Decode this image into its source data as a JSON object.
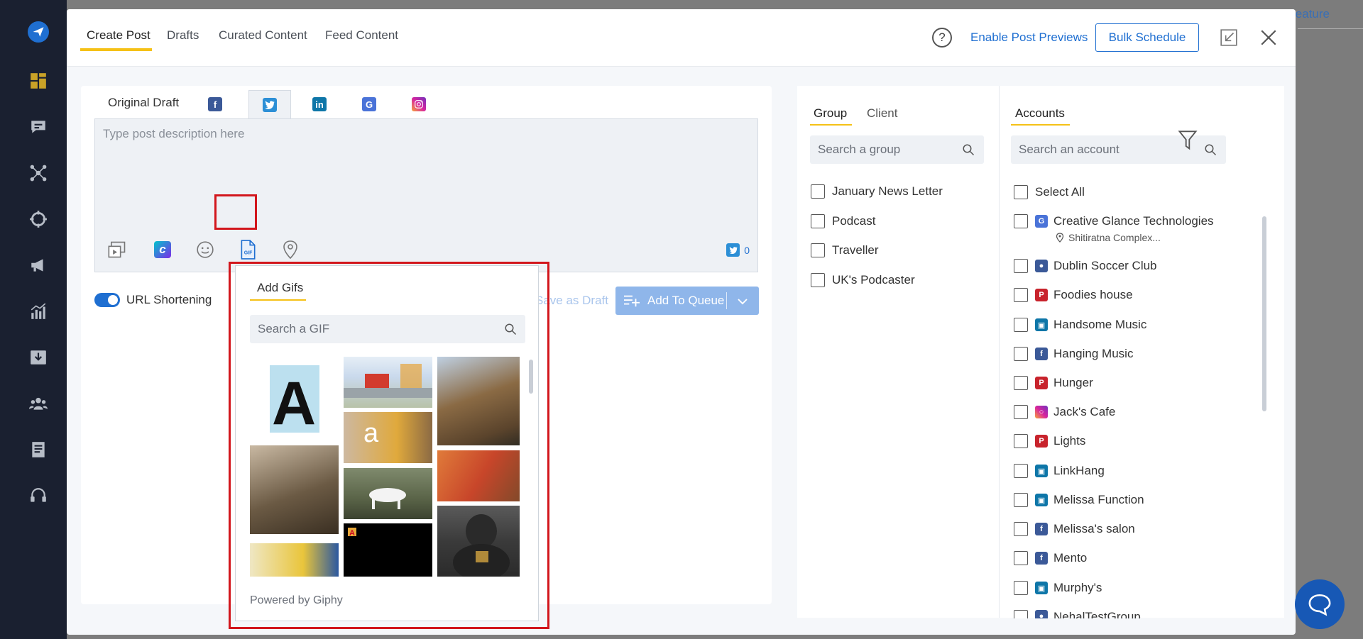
{
  "background": {
    "feature_text": "eature"
  },
  "header": {
    "tabs": [
      {
        "label": "Create Post"
      },
      {
        "label": "Drafts"
      },
      {
        "label": "Curated Content"
      },
      {
        "label": "Feed Content"
      }
    ],
    "help_glyph": "?",
    "enable_previews": "Enable Post Previews",
    "bulk_schedule": "Bulk Schedule"
  },
  "composer": {
    "original_draft": "Original Draft",
    "placeholder": "Type post description here",
    "char_count": "0",
    "url_shortening": "URL Shortening",
    "save_as_draft": "Save as Draft",
    "add_to_queue": "Add To Queue"
  },
  "gif_popup": {
    "title": "Add Gifs",
    "search_placeholder": "Search a GIF",
    "powered_by": "Powered by Giphy"
  },
  "groups": {
    "tabs": [
      {
        "label": "Group"
      },
      {
        "label": "Client"
      }
    ],
    "search_placeholder": "Search a group",
    "items": [
      {
        "label": "January News Letter"
      },
      {
        "label": "Podcast"
      },
      {
        "label": "Traveller"
      },
      {
        "label": "UK's Podcaster"
      }
    ]
  },
  "accounts": {
    "tab": "Accounts",
    "search_placeholder": "Search an account",
    "select_all": "Select All",
    "items": [
      {
        "label": "Creative Glance Technologies",
        "type": "gmb",
        "sub": "Shitiratna Complex..."
      },
      {
        "label": "Dublin Soccer Club",
        "type": "fb-group"
      },
      {
        "label": "Foodies house",
        "type": "pinterest"
      },
      {
        "label": "Handsome Music",
        "type": "linkedin-page"
      },
      {
        "label": "Hanging Music",
        "type": "facebook"
      },
      {
        "label": "Hunger",
        "type": "pinterest"
      },
      {
        "label": "Jack's Cafe",
        "type": "instagram"
      },
      {
        "label": "Lights",
        "type": "pinterest"
      },
      {
        "label": "LinkHang",
        "type": "linkedin-page"
      },
      {
        "label": "Melissa Function",
        "type": "linkedin-page"
      },
      {
        "label": "Melissa's salon",
        "type": "facebook"
      },
      {
        "label": "Mento",
        "type": "facebook"
      },
      {
        "label": "Murphy's",
        "type": "linkedin-page"
      },
      {
        "label": "NehalTestGroup",
        "type": "fb-group"
      }
    ]
  },
  "colors": {
    "accent": "#1f6fd1",
    "underline": "#f5c117",
    "highlight": "#d2161c",
    "sidebar": "#1a2030"
  }
}
